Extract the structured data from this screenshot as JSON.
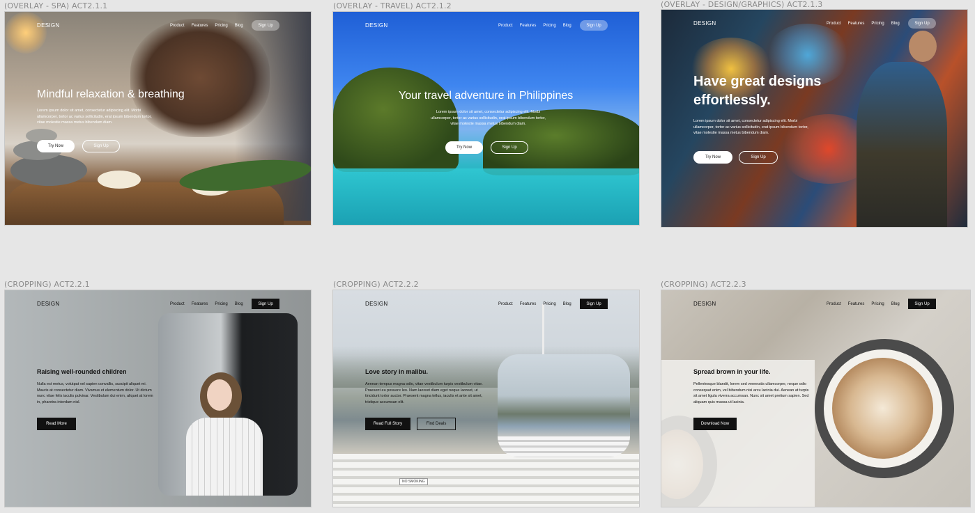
{
  "frames": [
    {
      "label": "(OVERLAY - SPA) ACT2.1.1",
      "logo": "DESIGN",
      "nav": [
        "Product",
        "Features",
        "Pricing",
        "Blog"
      ],
      "signup": "Sign Up",
      "headline": "Mindful relaxation & breathing",
      "body": "Lorem ipsum dolor sit amet, consectetur adipiscing elit. Morbi ullamcorper, tortor ac varius sollicitudin, erat ipsum bibendum tortor, vitae molestie massa metus bibendum diam.",
      "btn1": "Try Now",
      "btn2": "Sign Up"
    },
    {
      "label": "(OVERLAY - TRAVEL) ACT2.1.2",
      "logo": "DESIGN",
      "nav": [
        "Product",
        "Features",
        "Pricing",
        "Blog"
      ],
      "signup": "Sign Up",
      "headline": "Your travel adventure in Philippines",
      "body": "Lorem ipsum dolor sit amet, consectetur adipiscing elit. Morbi ullamcorper, tortor ac varius sollicitudin, erat ipsum bibendum tortor, vitae molestie massa metus bibendum diam.",
      "btn1": "Try Now",
      "btn2": "Sign Up"
    },
    {
      "label": "(OVERLAY - DESIGN/GRAPHICS) ACT2.1.3",
      "logo": "DESIGN",
      "nav": [
        "Product",
        "Features",
        "Pricing",
        "Blog"
      ],
      "signup": "Sign Up",
      "headline1": "Have great designs",
      "headline2": "effortlessly.",
      "body": "Lorem ipsum dolor sit amet, consectetur adipiscing elit. Morbi ullamcorper, tortor ac varius sollicitudin, erat ipsum bibendum tortor, vitae molestie massa metus bibendum diam.",
      "btn1": "Try Now",
      "btn2": "Sign Up"
    },
    {
      "label": "(CROPPING) ACT2.2.1",
      "logo": "DESIGN",
      "nav": [
        "Product",
        "Features",
        "Pricing",
        "Blog"
      ],
      "signup": "Sign Up",
      "headline": "Raising well-rounded children",
      "body": "Nulla est metus, volutpat vel sapien convallis, suscipit aliquet mi. Mauris at consectetur diam. Vivamus et elementum dolor. Ut dictum nunc vitae felis iaculis pulvinar. Vestibulum dui enim, aliquet at lorem in, pharetra interdum nisl.",
      "btn1": "Read More"
    },
    {
      "label": "(CROPPING) ACT2.2.2",
      "logo": "DESIGN",
      "nav": [
        "Product",
        "Features",
        "Pricing",
        "Blog"
      ],
      "signup": "Sign Up",
      "headline": "Love story in malibu.",
      "body": "Aenean tempus magna odio, vitae vestibulum turpis vestibulum vitae. Praesent eu posuere leo. Nam laoreet diam eget neque laoreet, ut tincidunt tortor auctor. Praesent magna tellus, iaculis et ante sit amet, tristique accumsan elit.",
      "btn1": "Read Full Story",
      "btn2": "Find Deals",
      "sign": "NO SMOKING"
    },
    {
      "label": "(CROPPING) ACT2.2.3",
      "logo": "DESIGN",
      "nav": [
        "Product",
        "Features",
        "Pricing",
        "Blog"
      ],
      "signup": "Sign Up",
      "headline": "Spread brown in your life.",
      "body": "Pellentesque blandit, lorem sed venenatis ullamcorper, neque odio consequat enim, vel bibendum nisi arcu lacinia dui. Aenean at turpis sit amet ligula viverra accumsan. Nunc sit amet pretium sapien. Sed aliquam quis massa ut lacinia.",
      "btn1": "Download Now"
    }
  ]
}
